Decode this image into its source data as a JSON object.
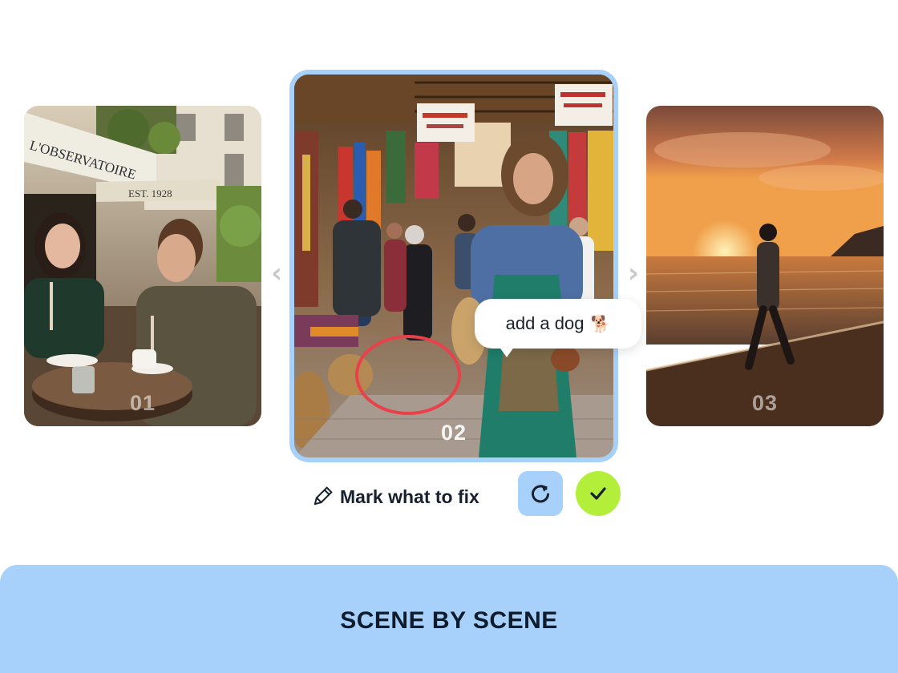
{
  "cards": [
    {
      "number": "01",
      "image": "cafe-couple-photo",
      "sign_text": "L'OBSERVATOIRE",
      "awning_text": "EST. 1928"
    },
    {
      "number": "02",
      "image": "market-woman-photo",
      "selected": true
    },
    {
      "number": "03",
      "image": "beach-sunset-photo"
    }
  ],
  "carousel": {
    "prev_icon": "chevron-left-icon",
    "next_icon": "chevron-right-icon"
  },
  "annotation": {
    "text": "add a dog",
    "emoji": "🐕",
    "mark": "red-circle"
  },
  "toolbar": {
    "mark_icon": "pencil-icon",
    "mark_label": "Mark what to fix",
    "redo_icon": "refresh-icon",
    "confirm_icon": "checkmark-icon"
  },
  "footer": {
    "title": "SCENE BY SCENE"
  },
  "colors": {
    "accent_blue": "#a7d0fb",
    "confirm_green": "#b3ee3a",
    "mark_red": "#e8414a",
    "text_dark": "#17202e"
  }
}
